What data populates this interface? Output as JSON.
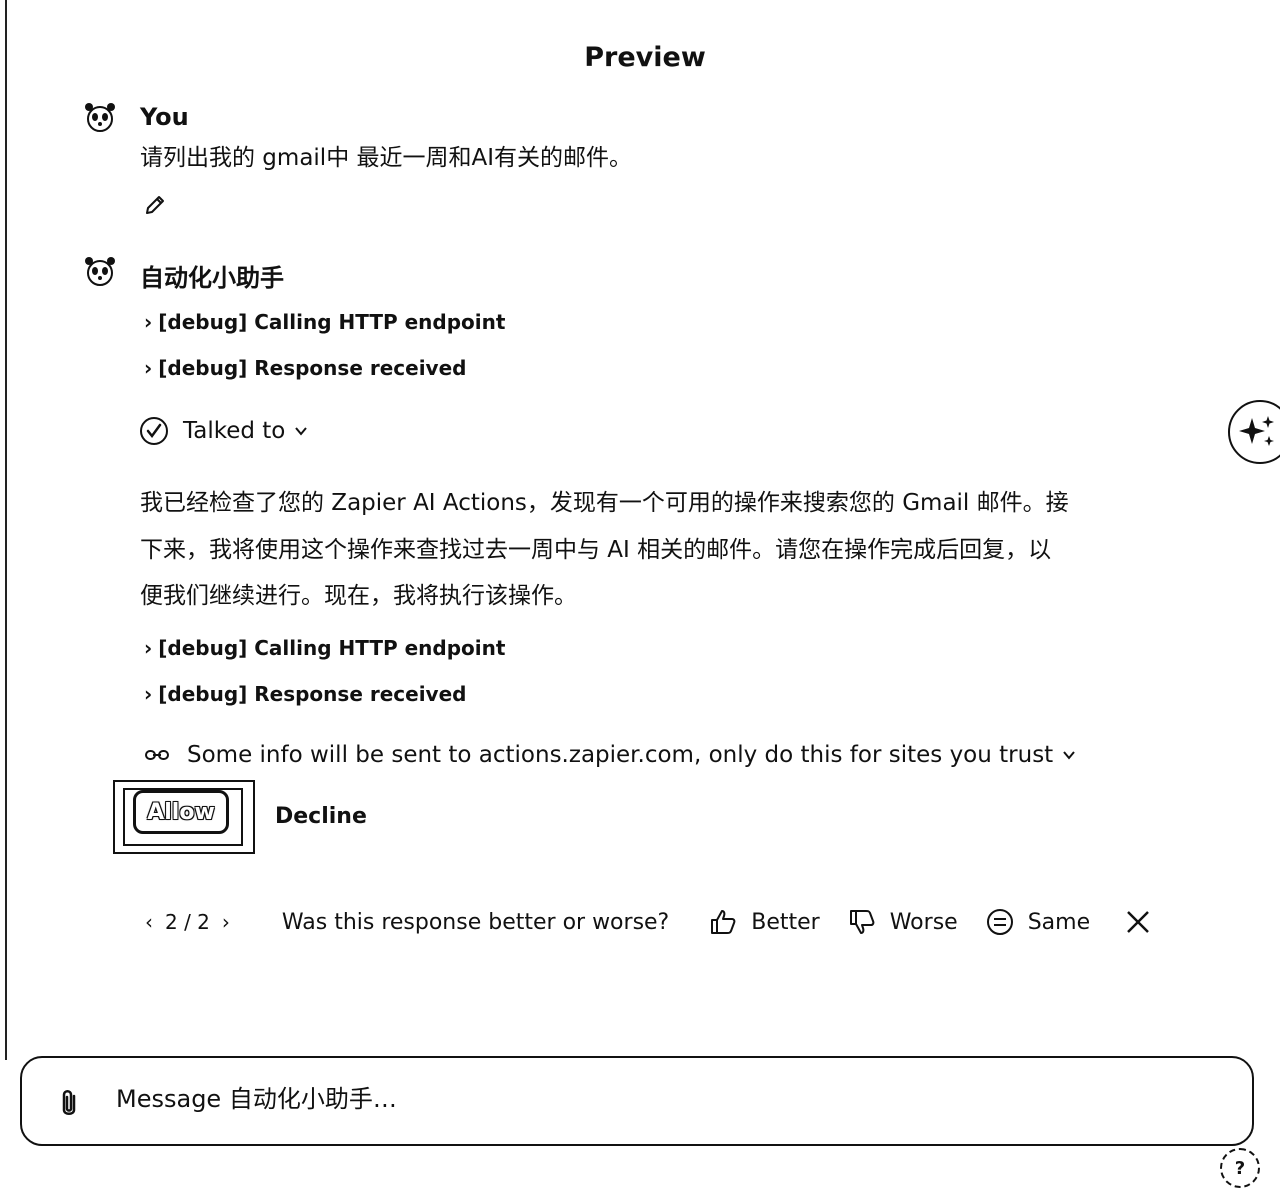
{
  "page": {
    "title": "Preview"
  },
  "messages": [
    {
      "author": "You",
      "text": "请列出我的 gmail中 最近一周和AI有关的邮件。"
    },
    {
      "author": "自动化小助手",
      "debug_1": "[debug] Calling HTTP endpoint",
      "debug_2": "[debug] Response received",
      "talked_to": "Talked to",
      "text_line1": "我已经检查了您的 Zapier AI Actions，发现有一个可用的操作来搜索您的 Gmail 邮件。接",
      "text_line2": "下来，我将使用这个操作来查找过去一周中与 AI 相关的邮件。请您在操作完成后回复，以",
      "text_line3": "便我们继续进行。现在，我将执行该操作。",
      "debug_3": "[debug] Calling HTTP endpoint",
      "debug_4": "[debug] Response received",
      "info_notice": "Some info will be sent to actions.zapier.com, only do this for sites you trust",
      "allow_label": "Allow",
      "decline_label": "Decline"
    }
  ],
  "feedback": {
    "pager": "2 / 2",
    "question": "Was this response better or worse?",
    "better": "Better",
    "worse": "Worse",
    "same": "Same"
  },
  "composer": {
    "placeholder": "Message 自动化小助手…"
  },
  "help": {
    "label": "?"
  }
}
